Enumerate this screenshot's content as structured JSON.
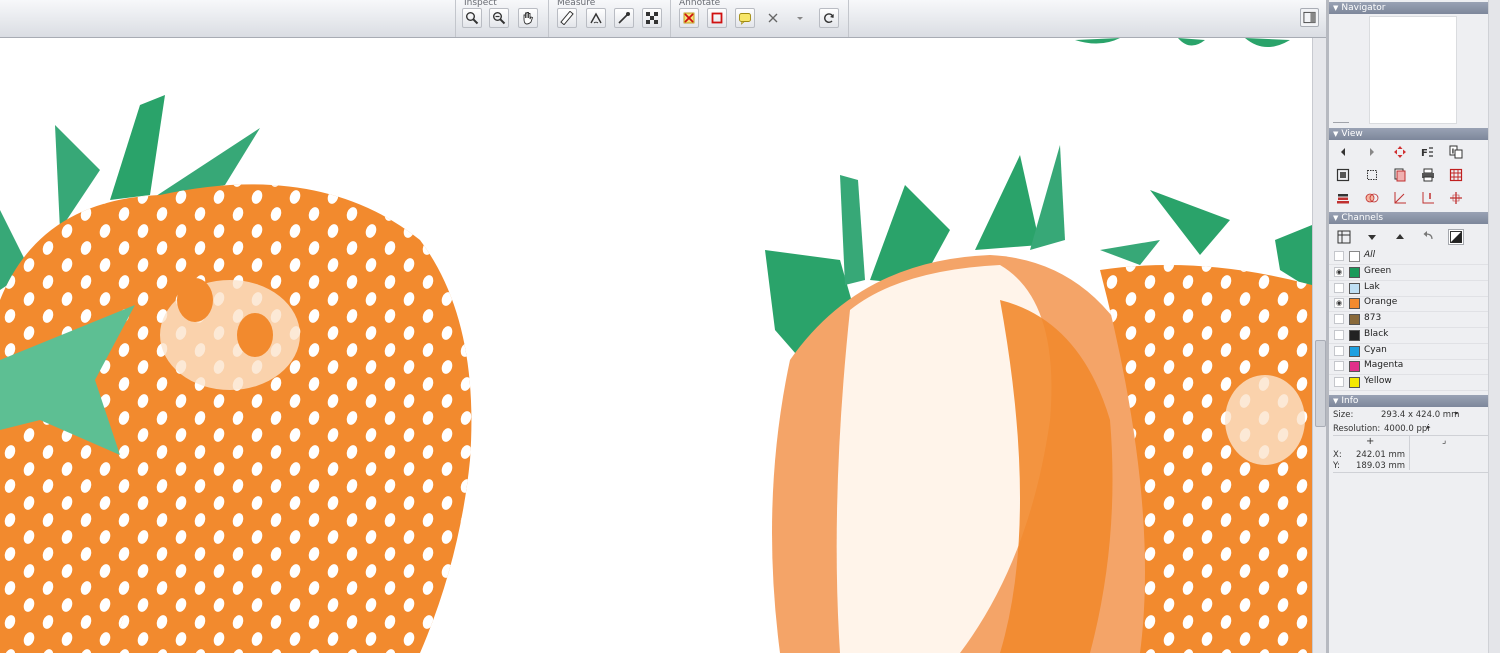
{
  "toolbar": {
    "groups": [
      {
        "label": "Inspect",
        "tools": [
          "zoom-in-icon",
          "zoom-out-icon",
          "hand-icon"
        ]
      },
      {
        "label": "Measure",
        "tools": [
          "ruler-icon",
          "angle-icon",
          "densitometer-icon",
          "checkerboard-icon"
        ]
      },
      {
        "label": "Annotate",
        "tools": [
          "delete-marker-icon",
          "rectangle-icon",
          "note-icon",
          "close-icon",
          "dropdown-icon",
          "refresh-icon"
        ]
      }
    ]
  },
  "panel": {
    "navigator": {
      "title": "Navigator"
    },
    "view": {
      "title": "View"
    },
    "channels": {
      "title": "Channels",
      "all_label": "All",
      "items": [
        {
          "name": "Green",
          "color": "#1a9a5a",
          "visible": true
        },
        {
          "name": "Lak",
          "color": "#bfe0f5",
          "visible": false
        },
        {
          "name": "Orange",
          "color": "#f28a2e",
          "visible": true
        },
        {
          "name": "873",
          "color": "#8a6a3a",
          "visible": false
        },
        {
          "name": "Black",
          "color": "#222222",
          "visible": false
        },
        {
          "name": "Cyan",
          "color": "#1ea0e0",
          "visible": false
        },
        {
          "name": "Magenta",
          "color": "#e0308a",
          "visible": false
        },
        {
          "name": "Yellow",
          "color": "#f5e800",
          "visible": false
        }
      ]
    },
    "info": {
      "title": "Info",
      "size_label": "Size:",
      "size_value": "293.4 x 424.0 mm",
      "resolution_label": "Resolution:",
      "resolution_value": "4000.0 ppi",
      "x_label": "X:",
      "x_value": "242.01 mm",
      "y_label": "Y:",
      "y_value": "189.03 mm"
    }
  },
  "colors": {
    "orange": "#f28a2e",
    "green": "#2aa36a",
    "panel_header": "#8891a4"
  }
}
